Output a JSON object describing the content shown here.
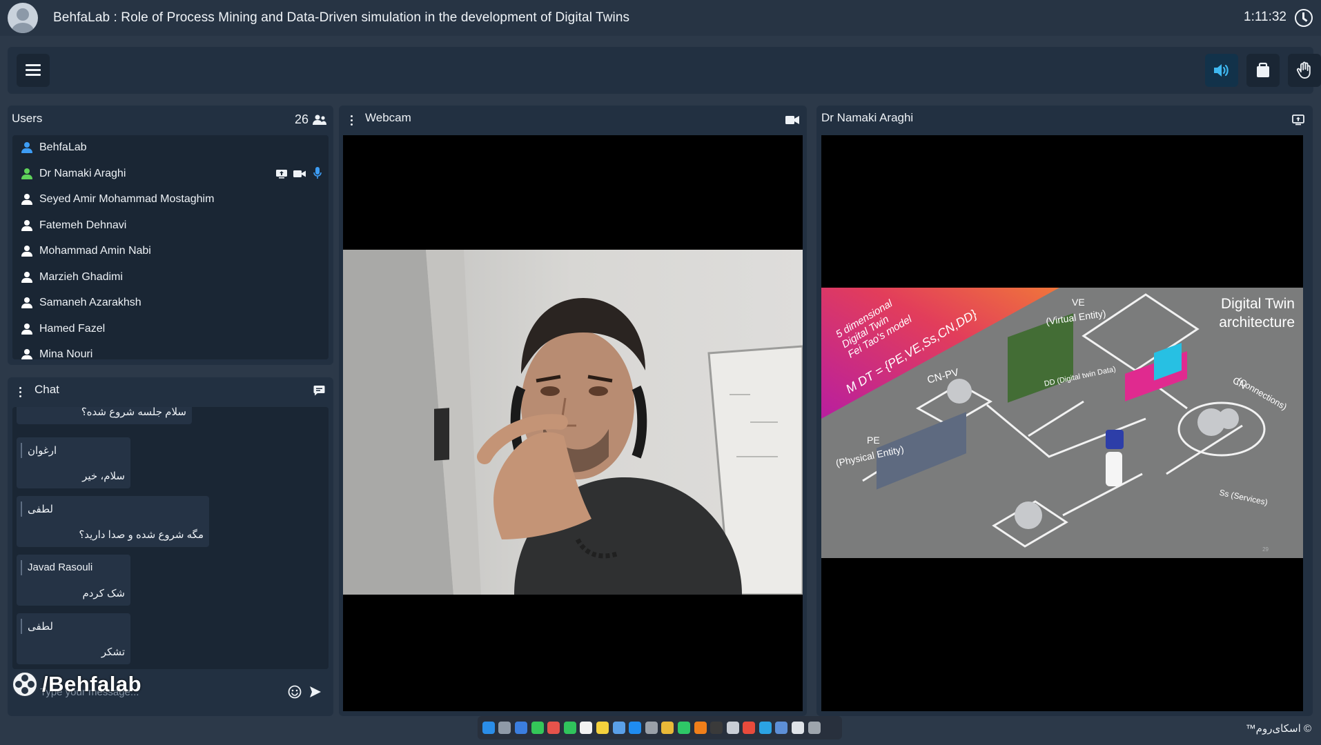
{
  "window": {
    "title": "BehfaLab : Role of Process Mining and Data-Driven simulation in the development of Digital Twins",
    "time": "1:11:32"
  },
  "toolbar": {
    "menu_icon": "hamburger-menu-icon",
    "audio_icon": "speaker-icon",
    "share_icon": "clipboard-icon",
    "hand_icon": "raise-hand-icon"
  },
  "users": {
    "title": "Users",
    "count": "26",
    "items": [
      {
        "name": "BehfaLab",
        "color": "#3d9df5"
      },
      {
        "name": "Dr Namaki Araghi",
        "color": "#5fd35a"
      },
      {
        "name": "Seyed Amir Mohammad Mostaghim",
        "color": "#ffffff"
      },
      {
        "name": "Fatemeh Dehnavi",
        "color": "#ffffff"
      },
      {
        "name": "Mohammad Amin Nabi",
        "color": "#ffffff"
      },
      {
        "name": "Marzieh Ghadimi",
        "color": "#ffffff"
      },
      {
        "name": "Samaneh Azarakhsh",
        "color": "#ffffff"
      },
      {
        "name": "Hamed Fazel",
        "color": "#ffffff"
      },
      {
        "name": "Mina Nouri",
        "color": "#ffffff"
      }
    ]
  },
  "chat": {
    "title": "Chat",
    "messages": [
      {
        "sender": "",
        "text": "سلام جلسه شروع شده؟"
      },
      {
        "sender": "ارغوان",
        "text": "سلام، خیر"
      },
      {
        "sender": "لطفی",
        "text": "مگه شروع شده و صدا دارید؟"
      },
      {
        "sender": "Javad Rasouli",
        "text": "شک کردم"
      },
      {
        "sender": "لطفی",
        "text": "تشکر"
      }
    ],
    "input_placeholder": "Type your message...",
    "watermark": "/Behfalab"
  },
  "webcam": {
    "title": "Webcam"
  },
  "presenter": {
    "title": "Dr Namaki Araghi",
    "slide": {
      "heading_line1": "Digital Twin",
      "heading_line2": "architecture",
      "banner_line1": "5 dimensional",
      "banner_line2": "Digital Twin",
      "banner_line3": "Fei Tao's model",
      "formula": "M DT = {PE,VE,Ss,CN,DD}",
      "ve_label": "VE",
      "ve_sub": "(Virtual Entity)",
      "cnpv_label": "CN-PV",
      "dd_label": "DD (Digital twin Data)",
      "cn_label": "CN",
      "cn_sub": "(Connections)",
      "pe_label": "PE",
      "pe_sub": "(Physical Entity)",
      "ss_label": "Ss (Services)",
      "page": "29"
    }
  },
  "footer": {
    "brand": "© اسکای‌روم™"
  }
}
